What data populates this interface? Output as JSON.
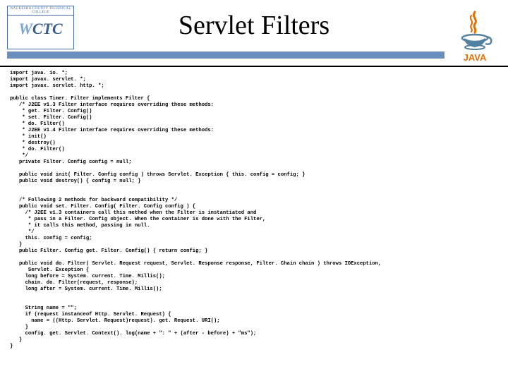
{
  "header": {
    "title": "Servlet Filters",
    "leftLogo": {
      "banner": "WAUKESHA COUNTY TECHNICAL COLLEGE",
      "w": "W",
      "ctc": "CTC"
    }
  },
  "code": "import java. io. *;\nimport javax. servlet. *;\nimport javax. servlet. http. *;\n\npublic class Timer. Filter implements Filter {\n   /* J2EE v1.3 Filter interface requires overriding these methods:\n    * get. Filter. Config()\n    * set. Filter. Config()\n    * do. Filter()\n    * J2EE v1.4 Filter interface requires overriding these methods:\n    * init()\n    * destroy()\n    * do. Filter()\n    */\n   private Filter. Config config = null;\n\n   public void init( Filter. Config config ) throws Servlet. Exception { this. config = config; }\n   public void destroy() { config = null; }\n\n\n   /* Following 2 methods for backward compatibility */\n   public void set. Filter. Config( Filter. Config config ) {\n     /* J2EE v1.3 containers call this method when the Filter is instantiated and\n      * pass in a Filter. Config object. When the container is done with the Filter,\n      * it calls this method, passing in null.\n      */\n     this. config = config;\n   }\n   public Filter. Config get. Filter. Config() { return config; }\n\n   public void do. Filter( Servlet. Request request, Servlet. Response response, Filter. Chain chain ) throws IOException,\n      Servlet. Exception {\n     long before = System. current. Time. Millis();\n     chain. do. Filter(request, response);\n     long after = System. current. Time. Millis();\n\n\n     String name = \"\";\n     if (request instanceof Http. Servlet. Request) {\n       name = ((Http. Servlet. Request)request). get. Request. URI();\n     }\n     config. get. Servlet. Context(). log(name + \": \" + (after - before) + \"ms\");\n   }\n}"
}
